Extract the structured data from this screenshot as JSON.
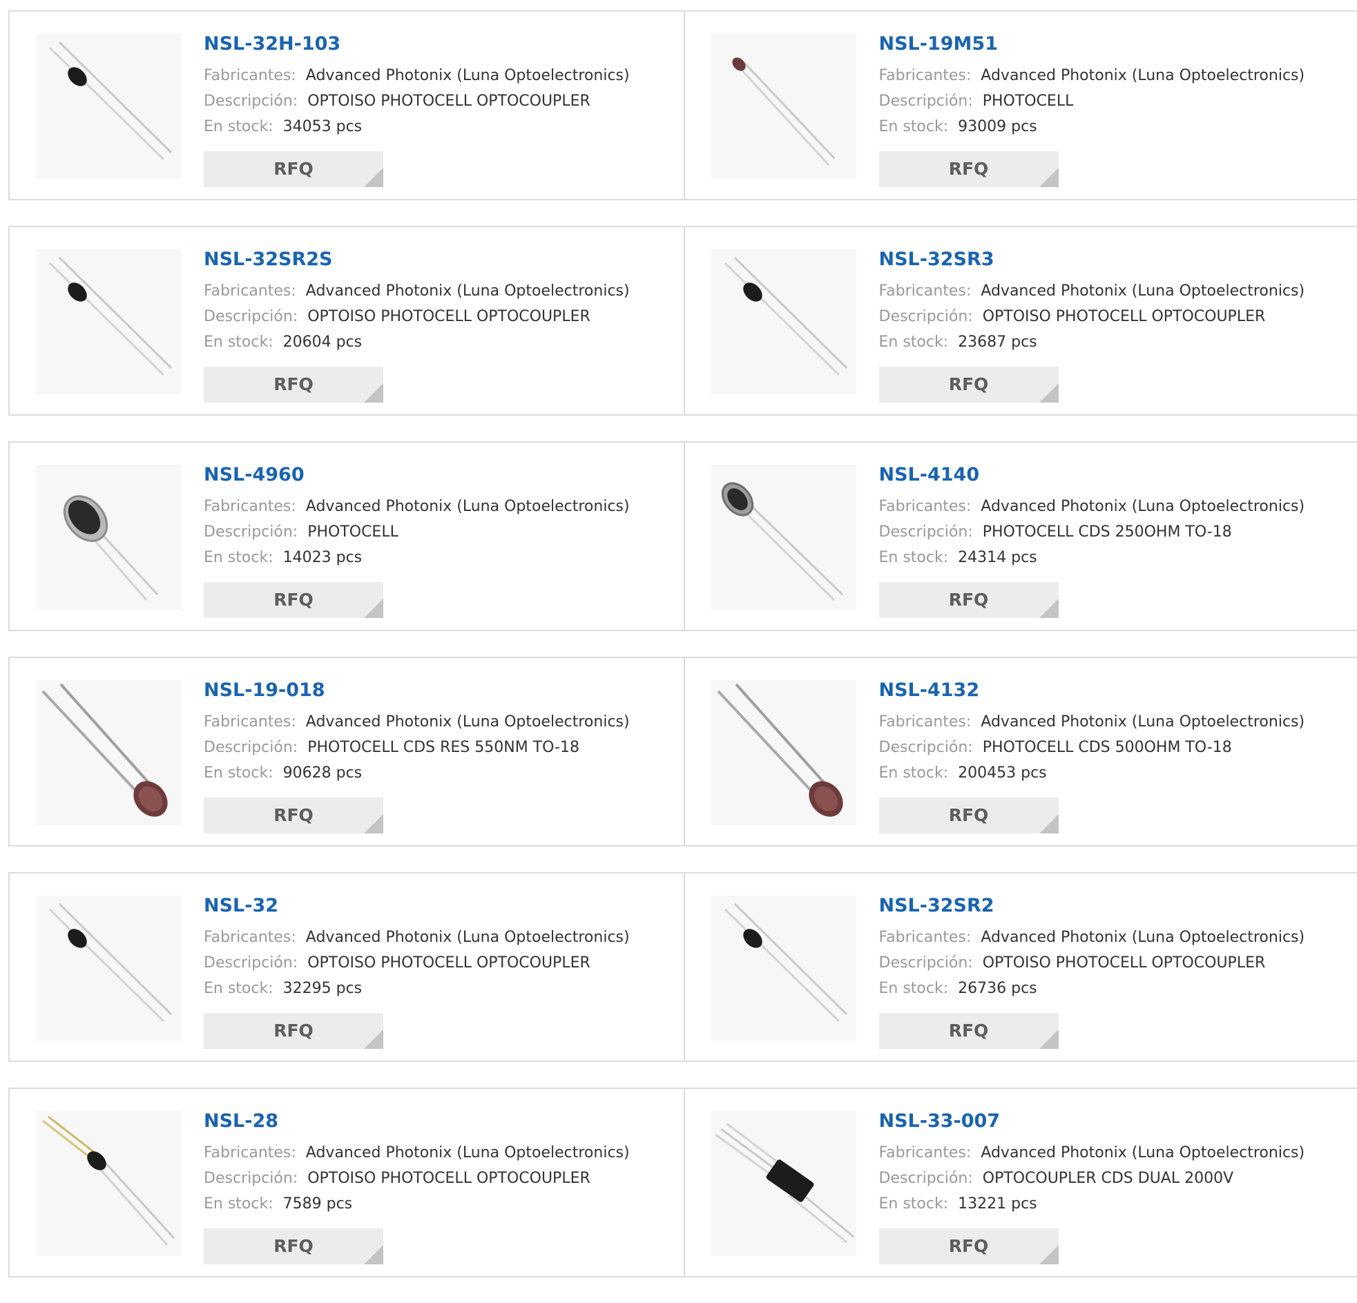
{
  "labels": {
    "manufacturer": "Fabricantes:",
    "description": "Descripción:",
    "stock": "En stock:",
    "rfq": "RFQ"
  },
  "colors": {
    "part_link": "#1a64b0",
    "label_gray": "#999999",
    "button_bg": "#ececec"
  },
  "products": [
    {
      "pn": "NSL-32H-103",
      "manufacturer": "Advanced Photonix (Luna Optoelectronics)",
      "description": "OPTOISO PHOTOCELL OPTOCOUPLER",
      "stock": "34053 pcs",
      "icon": "optoisolator-icon"
    },
    {
      "pn": "NSL-19M51",
      "manufacturer": "Advanced Photonix (Luna Optoelectronics)",
      "description": "PHOTOCELL",
      "stock": "93009 pcs",
      "icon": "photocell-small-icon"
    },
    {
      "pn": "NSL-32SR2S",
      "manufacturer": "Advanced Photonix (Luna Optoelectronics)",
      "description": "OPTOISO PHOTOCELL OPTOCOUPLER",
      "stock": "20604 pcs",
      "icon": "optoisolator-icon"
    },
    {
      "pn": "NSL-32SR3",
      "manufacturer": "Advanced Photonix (Luna Optoelectronics)",
      "description": "OPTOISO PHOTOCELL OPTOCOUPLER",
      "stock": "23687 pcs",
      "icon": "optoisolator-icon"
    },
    {
      "pn": "NSL-4960",
      "manufacturer": "Advanced Photonix (Luna Optoelectronics)",
      "description": "PHOTOCELL",
      "stock": "14023 pcs",
      "icon": "photocell-can-icon"
    },
    {
      "pn": "NSL-4140",
      "manufacturer": "Advanced Photonix (Luna Optoelectronics)",
      "description": "PHOTOCELL CDS 250OHM TO-18",
      "stock": "24314 pcs",
      "icon": "photocell-to18-icon"
    },
    {
      "pn": "NSL-19-018",
      "manufacturer": "Advanced Photonix (Luna Optoelectronics)",
      "description": "PHOTOCELL CDS RES 550NM TO-18",
      "stock": "90628 pcs",
      "icon": "photocell-cds-icon"
    },
    {
      "pn": "NSL-4132",
      "manufacturer": "Advanced Photonix (Luna Optoelectronics)",
      "description": "PHOTOCELL CDS 500OHM TO-18",
      "stock": "200453 pcs",
      "icon": "photocell-cds-icon"
    },
    {
      "pn": "NSL-32",
      "manufacturer": "Advanced Photonix (Luna Optoelectronics)",
      "description": "OPTOISO PHOTOCELL OPTOCOUPLER",
      "stock": "32295 pcs",
      "icon": "optoisolator-icon"
    },
    {
      "pn": "NSL-32SR2",
      "manufacturer": "Advanced Photonix (Luna Optoelectronics)",
      "description": "OPTOISO PHOTOCELL OPTOCOUPLER",
      "stock": "26736 pcs",
      "icon": "optoisolator-icon"
    },
    {
      "pn": "NSL-28",
      "manufacturer": "Advanced Photonix (Luna Optoelectronics)",
      "description": "OPTOISO PHOTOCELL OPTOCOUPLER",
      "stock": "7589 pcs",
      "icon": "optoisolator-gold-leads-icon"
    },
    {
      "pn": "NSL-33-007",
      "manufacturer": "Advanced Photonix (Luna Optoelectronics)",
      "description": "OPTOCOUPLER CDS DUAL 2000V",
      "stock": "13221 pcs",
      "icon": "optocoupler-dual-icon"
    }
  ]
}
